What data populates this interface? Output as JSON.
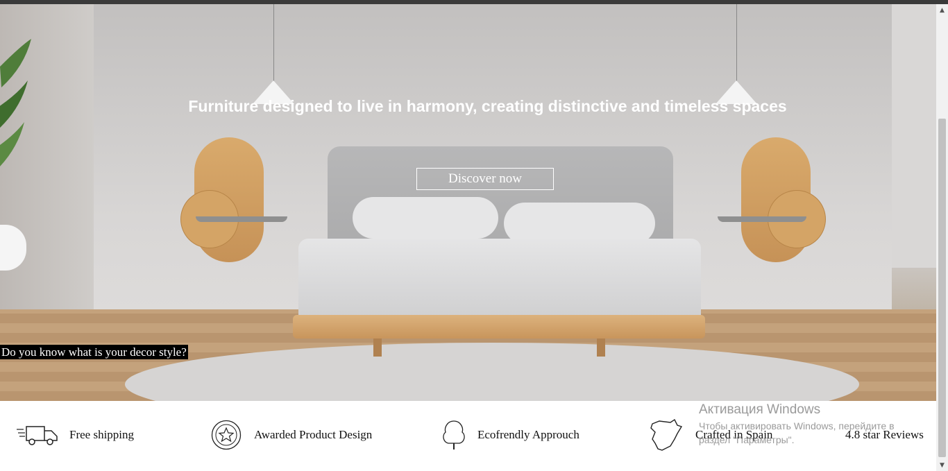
{
  "hero": {
    "title": "Furniture designed to live in harmony, creating distinctive and timeless spaces",
    "cta_label": "Discover now",
    "quiz_link": "Do you know what is your decor style?"
  },
  "features": [
    {
      "label": "Free shipping",
      "icon": "delivery-truck-icon"
    },
    {
      "label": "Awarded Product Design",
      "icon": "award-star-icon"
    },
    {
      "label": "Ecofrendly Approuch",
      "icon": "tree-icon"
    },
    {
      "label": "Crafted in Spain",
      "icon": "spain-map-icon"
    },
    {
      "label": "4.8 star Reviews",
      "icon": ""
    }
  ],
  "watermark": {
    "title": "Активация Windows",
    "line1": "Чтобы активировать Windows, перейдите в",
    "line2": "раздел \"Параметры\"."
  },
  "scrollbar": {
    "up": "▲",
    "down": "▼"
  }
}
